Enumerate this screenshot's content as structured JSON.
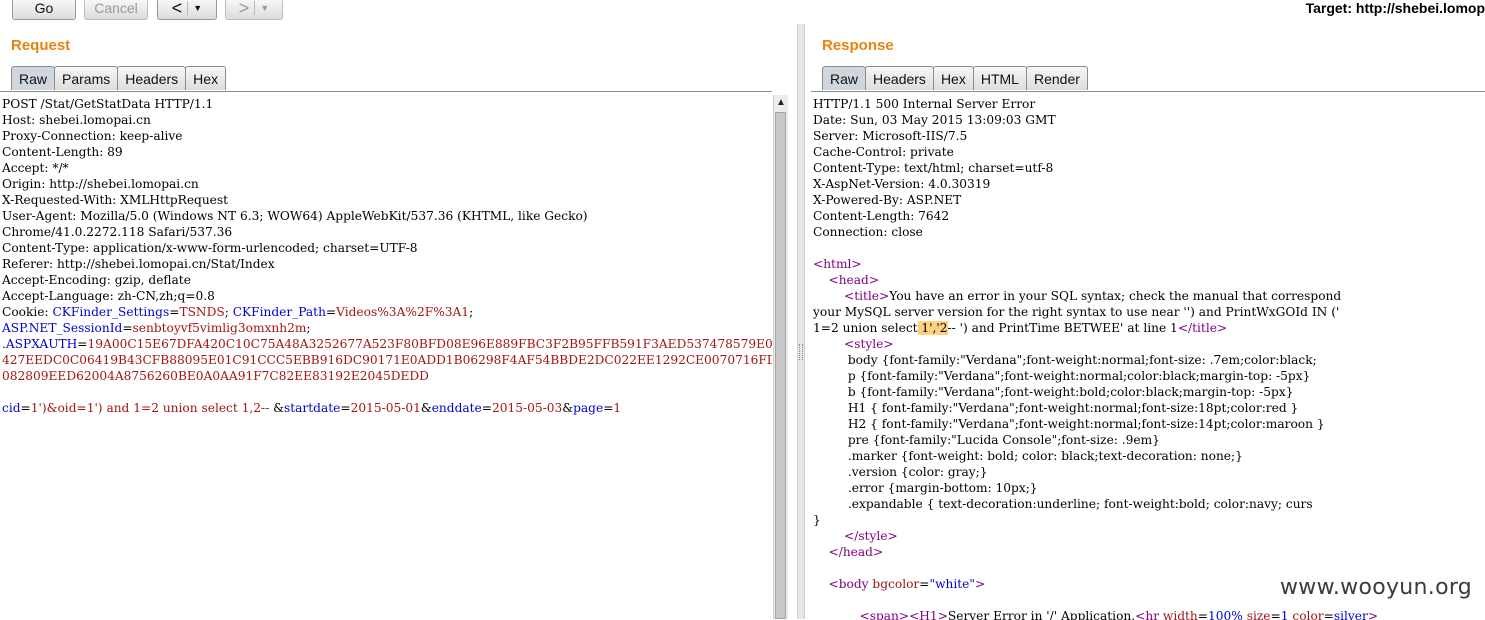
{
  "toolbar": {
    "go_label": "Go",
    "cancel_label": "Cancel",
    "back_glyph": "<",
    "forward_glyph": ">",
    "dropdown_glyph": "▼",
    "target_text": "Target: http://shebei.lomop"
  },
  "request": {
    "title": "Request",
    "tabs": [
      "Raw",
      "Params",
      "Headers",
      "Hex"
    ],
    "active_tab": "Raw"
  },
  "response": {
    "title": "Response",
    "tabs": [
      "Raw",
      "Headers",
      "Hex",
      "HTML",
      "Render"
    ],
    "active_tab": "Raw"
  },
  "colors": {
    "accent": "#e8830f",
    "key": "#0000cc",
    "value": "#a31515",
    "tag": "#800080",
    "highlight": "#ffd080"
  },
  "icons": {
    "scroll_up": "▲"
  },
  "watermark": "www.wooyun.org"
}
